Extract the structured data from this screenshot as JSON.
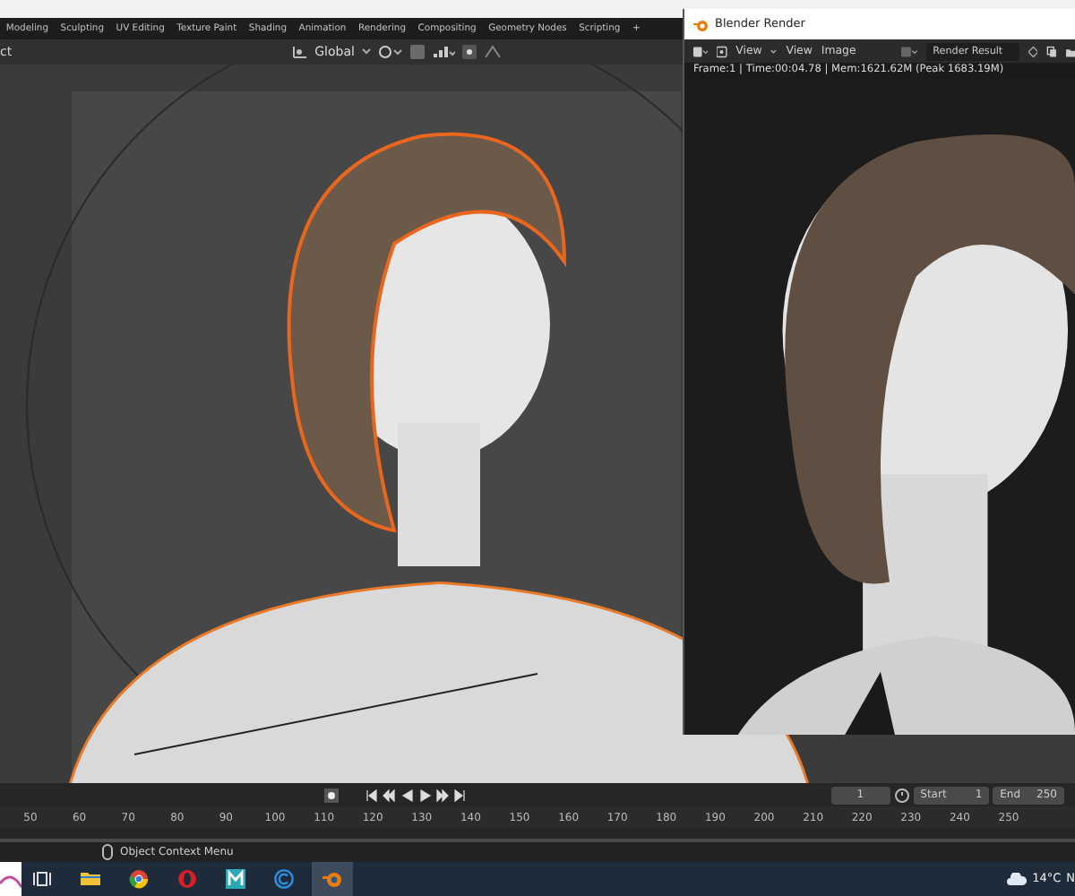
{
  "workspace_tabs": [
    {
      "label": "Modeling"
    },
    {
      "label": "Sculpting"
    },
    {
      "label": "UV Editing"
    },
    {
      "label": "Texture Paint"
    },
    {
      "label": "Shading"
    },
    {
      "label": "Animation"
    },
    {
      "label": "Rendering"
    },
    {
      "label": "Compositing"
    },
    {
      "label": "Geometry Nodes"
    },
    {
      "label": "Scripting"
    }
  ],
  "add_tab": "+",
  "header": {
    "mode_text": "ct",
    "orientation": "Global"
  },
  "render_window": {
    "title": "Blender Render",
    "menu": [
      "View",
      "View",
      "Image"
    ],
    "slot": "Render Result",
    "info": "Frame:1 | Time:00:04.78 | Mem:1621.62M (Peak 1683.19M)"
  },
  "timeline": {
    "current_frame": "1",
    "start_label": "Start",
    "start": "1",
    "end_label": "End",
    "end": "250",
    "ruler": [
      "50",
      "60",
      "70",
      "80",
      "90",
      "100",
      "110",
      "120",
      "130",
      "140",
      "150",
      "160",
      "170",
      "180",
      "190",
      "200",
      "210",
      "220",
      "230",
      "240",
      "250"
    ]
  },
  "status_bar": {
    "hint": "Object Context Menu"
  },
  "taskbar": {
    "apps": [
      {
        "kind": "folder",
        "selected": false
      },
      {
        "kind": "ring",
        "selected": false
      },
      {
        "kind": "red-ring",
        "selected": false
      },
      {
        "kind": "tile",
        "selected": false
      },
      {
        "kind": "c-circle",
        "selected": false
      },
      {
        "kind": "blender",
        "selected": true
      }
    ],
    "weather": "14°C",
    "clock": "N"
  }
}
